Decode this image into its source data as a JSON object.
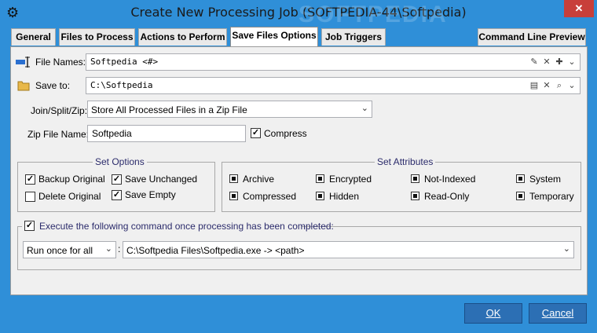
{
  "window": {
    "title": "Create New Processing Job (SOFTPEDIA-44\\Softpedia)",
    "close_label": "✕"
  },
  "tabs": [
    {
      "label": "General"
    },
    {
      "label": "Files to Process"
    },
    {
      "label": "Actions to Perform"
    },
    {
      "label": "Save Files Options"
    },
    {
      "label": "Job Triggers"
    },
    {
      "label": "Command Line Preview"
    }
  ],
  "file_names": {
    "label": "File Names:",
    "value": "Softpedia <#>"
  },
  "save_to": {
    "label": "Save to:",
    "value": "C:\\Softpedia"
  },
  "join_split_zip": {
    "label": "Join/Split/Zip:",
    "selected": "Store All Processed Files in a Zip File"
  },
  "zip_file_name": {
    "label": "Zip File Name:",
    "value": "Softpedia"
  },
  "compress": {
    "label": "Compress",
    "checked": true
  },
  "set_options": {
    "title": "Set Options",
    "items": [
      {
        "label": "Backup Original",
        "checked": true
      },
      {
        "label": "Save Unchanged",
        "checked": true
      },
      {
        "label": "Delete Original",
        "checked": false
      },
      {
        "label": "Save Empty",
        "checked": true
      }
    ]
  },
  "set_attributes": {
    "title": "Set Attributes",
    "items": [
      {
        "label": "Archive"
      },
      {
        "label": "Encrypted"
      },
      {
        "label": "Not-Indexed"
      },
      {
        "label": "System"
      },
      {
        "label": "Compressed"
      },
      {
        "label": "Hidden"
      },
      {
        "label": "Read-Only"
      },
      {
        "label": "Temporary"
      }
    ]
  },
  "execute": {
    "label": "Execute the following command once processing has been completed:",
    "checked": true,
    "run_mode": "Run once for all",
    "separator": ":",
    "command": "C:\\Softpedia Files\\Softpedia.exe -> <path>"
  },
  "buttons": {
    "ok": "OK",
    "cancel": "Cancel"
  },
  "watermark": "SOFTPEDIA",
  "colors": {
    "frame": "#2f8fd8",
    "close": "#c83f3a",
    "button": "#2c6fb4"
  }
}
